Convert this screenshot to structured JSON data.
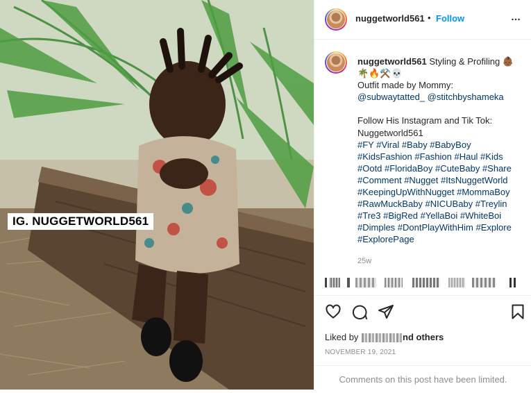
{
  "post": {
    "username": "nuggetworld561",
    "follow_label": "Follow",
    "separator": "•",
    "watermark": "IG. NUGGETWORLD561"
  },
  "caption": {
    "username": "nuggetworld561",
    "lines": [
      "Styling & Profiling 👶🏾",
      "🌴🔥⚒️💀",
      "Outfit made by Mommy:",
      "@subwaytatted_ @stitchbyshameka",
      "",
      "Follow His Instagram and Tik Tok:",
      "Nuggetworld561"
    ],
    "hashtags": [
      "#FY #Viral #Baby #BabyBoy",
      "#KidsFashion #Fashion #Haul #Kids",
      "#Ootd #FloridaBoy #CuteBaby #Share",
      "#Comment #Nugget #ItsNuggetWorld",
      "#KeepingUpWithNugget #MommaBoy",
      "#RawMuckBaby #NICUBaby #Treylin",
      "#Tre3 #BigRed #YellaBoi #WhiteBoi",
      "#Dimples #DontPlayWithHim #Explore",
      "#ExplorePage"
    ],
    "timestamp": "25w"
  },
  "likes": {
    "prefix": "Liked by",
    "suffix": "nd others"
  },
  "date": "NOVEMBER 19, 2021",
  "comments_note": "Comments on this post have been limited.",
  "icons": {
    "more": "more-options-icon",
    "like": "heart-icon",
    "comment": "comment-icon",
    "share": "share-icon",
    "save": "bookmark-icon"
  },
  "colors": {
    "follow": "#0095f6",
    "hashtag": "#00376b",
    "muted": "#8e8e8e"
  }
}
